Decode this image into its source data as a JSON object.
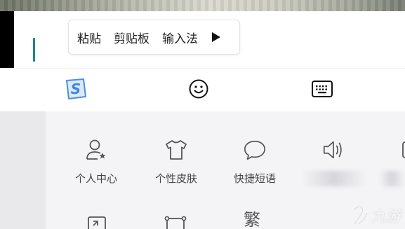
{
  "context_menu": {
    "items": [
      "粘贴",
      "剪贴板",
      "输入法"
    ]
  },
  "toolbar": {
    "buttons": [
      {
        "icon": "sogou-logo-icon"
      },
      {
        "icon": "emoji-icon"
      },
      {
        "icon": "keyboard-icon"
      }
    ]
  },
  "panel": {
    "tiles": [
      {
        "icon": "user-star-icon",
        "label": "个人中心"
      },
      {
        "icon": "tshirt-icon",
        "label": "个性皮肤"
      },
      {
        "icon": "speech-bubble-icon",
        "label": "快捷短语"
      },
      {
        "icon": "speaker-icon",
        "label": ""
      }
    ],
    "row2_traditional_char": "繁"
  },
  "watermark": {
    "text": "九游"
  },
  "colors": {
    "cursor": "#1b8a7a",
    "sogou_blue": "#4a8fe0",
    "panel_bg": "#f4f4f7"
  }
}
